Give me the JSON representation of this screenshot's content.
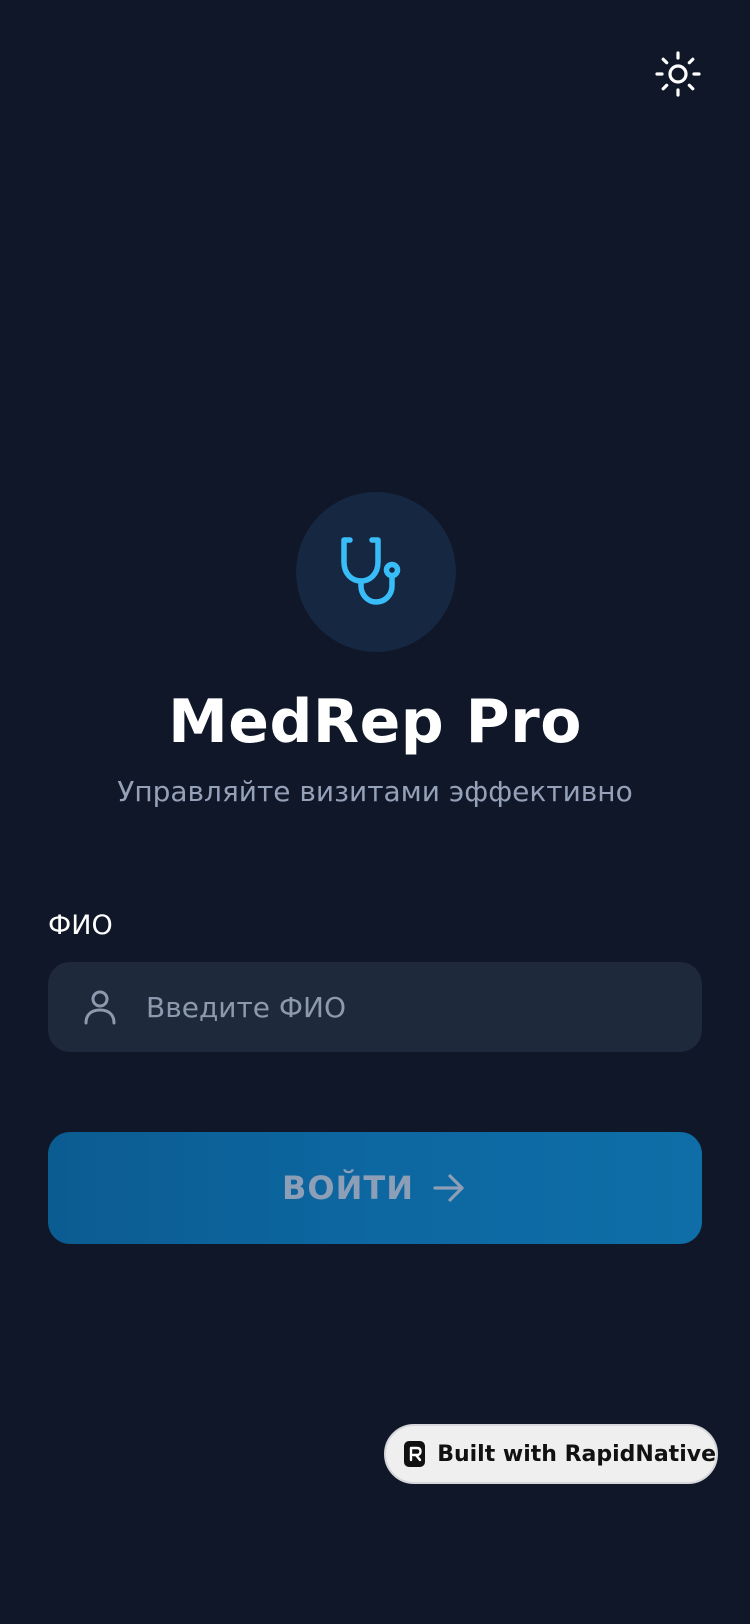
{
  "header": {
    "theme_toggle_icon": "sun-icon"
  },
  "brand": {
    "logo_icon": "stethoscope-icon",
    "title": "MedRep Pro",
    "subtitle": "Управляйте визитами эффективно",
    "accent_color": "#38bdf8"
  },
  "form": {
    "name_label": "ФИО",
    "name_icon": "user-icon",
    "name_value": "",
    "name_placeholder": "Введите ФИО"
  },
  "login_button": {
    "label": "ВОЙТИ",
    "icon": "arrow-right-icon"
  },
  "badge": {
    "label": "Built with RapidNative",
    "icon": "rapidnative-logo-icon"
  }
}
